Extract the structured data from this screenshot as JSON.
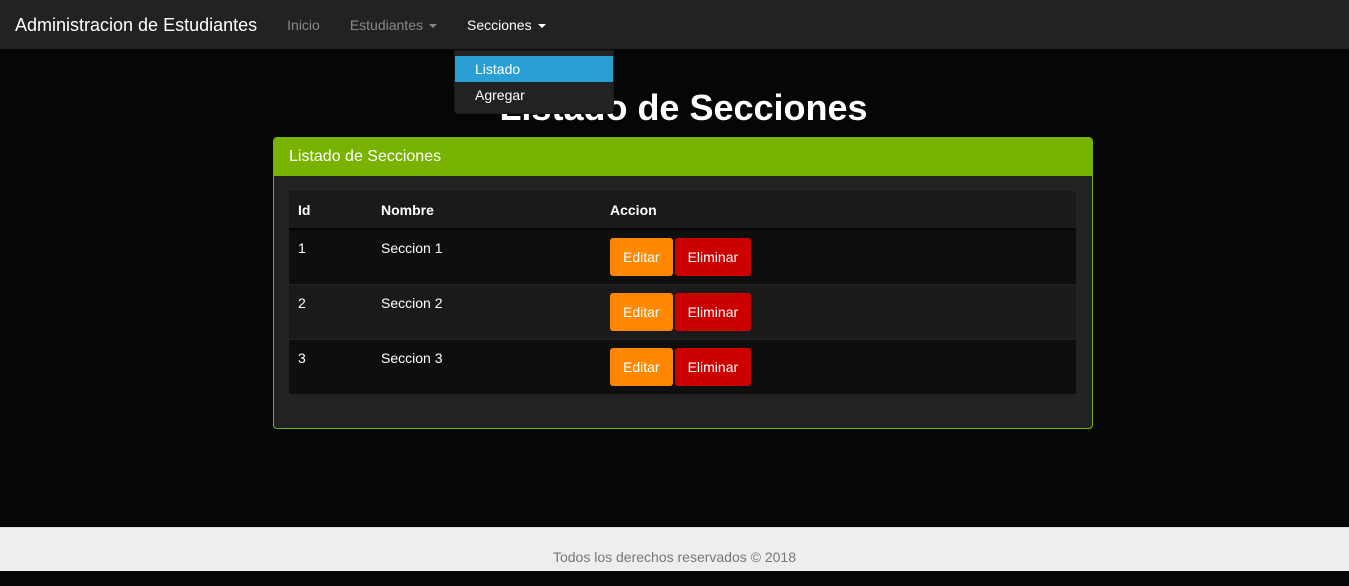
{
  "navbar": {
    "brand": "Administracion de Estudiantes",
    "items": [
      {
        "label": "Inicio"
      },
      {
        "label": "Estudiantes"
      },
      {
        "label": "Secciones"
      }
    ]
  },
  "dropdown": {
    "items": [
      {
        "label": "Listado"
      },
      {
        "label": "Agregar"
      }
    ]
  },
  "page": {
    "title": "Listado de Secciones"
  },
  "panel": {
    "heading": "Listado de Secciones",
    "table": {
      "headers": [
        "Id",
        "Nombre",
        "Accion"
      ],
      "rows": [
        {
          "id": "1",
          "nombre": "Seccion 1",
          "edit": "Editar",
          "delete": "Eliminar"
        },
        {
          "id": "2",
          "nombre": "Seccion 2",
          "edit": "Editar",
          "delete": "Eliminar"
        },
        {
          "id": "3",
          "nombre": "Seccion 3",
          "edit": "Editar",
          "delete": "Eliminar"
        }
      ]
    }
  },
  "footer": {
    "text": "Todos los derechos reservados © 2018"
  },
  "colors": {
    "navbar": "#222222",
    "accent_green": "#77b300",
    "dropdown_active": "#2a9fd6",
    "edit_button": "#ff8800",
    "delete_button": "#cc0000"
  }
}
